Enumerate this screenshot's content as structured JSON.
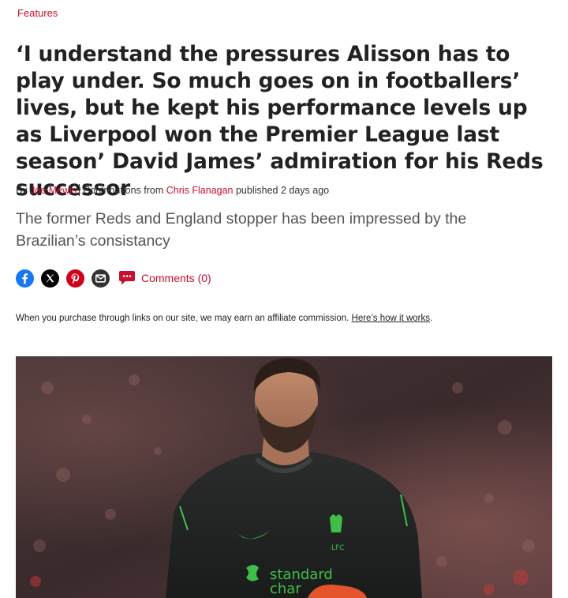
{
  "category": "Features",
  "headline": "‘I understand the pressures Alisson has to play under. So much goes on in footballers’ lives, but he kept his performance levels up as Liverpool won the Premier League last season’ David James’ admiration for his Reds successor",
  "byline": {
    "by": "By",
    "author": "Joe Mewis",
    "contrib_prefix": "Contributions from",
    "contributor": "Chris Flanagan",
    "published": "published 2 days ago"
  },
  "standfirst": "The former Reds and England stopper has been impressed by the Brazilian’s consistancy",
  "share": {
    "icons": [
      "facebook-icon",
      "x-icon",
      "pinterest-icon",
      "email-icon",
      "comment-bubble-icon"
    ],
    "comments_label": "Comments (0)",
    "colors": {
      "facebook": "#1877f2",
      "x": "#000000",
      "pinterest": "#d0021b",
      "email": "#333333",
      "accent": "#c8102e"
    }
  },
  "affiliate": {
    "text": "When you purchase through links on our site, we may earn an affiliate commission.",
    "link": "Here’s how it works",
    "end": "."
  },
  "hero": {
    "crest_text": "LFC",
    "sponsor_line1": "standard",
    "sponsor_line2": "char"
  }
}
